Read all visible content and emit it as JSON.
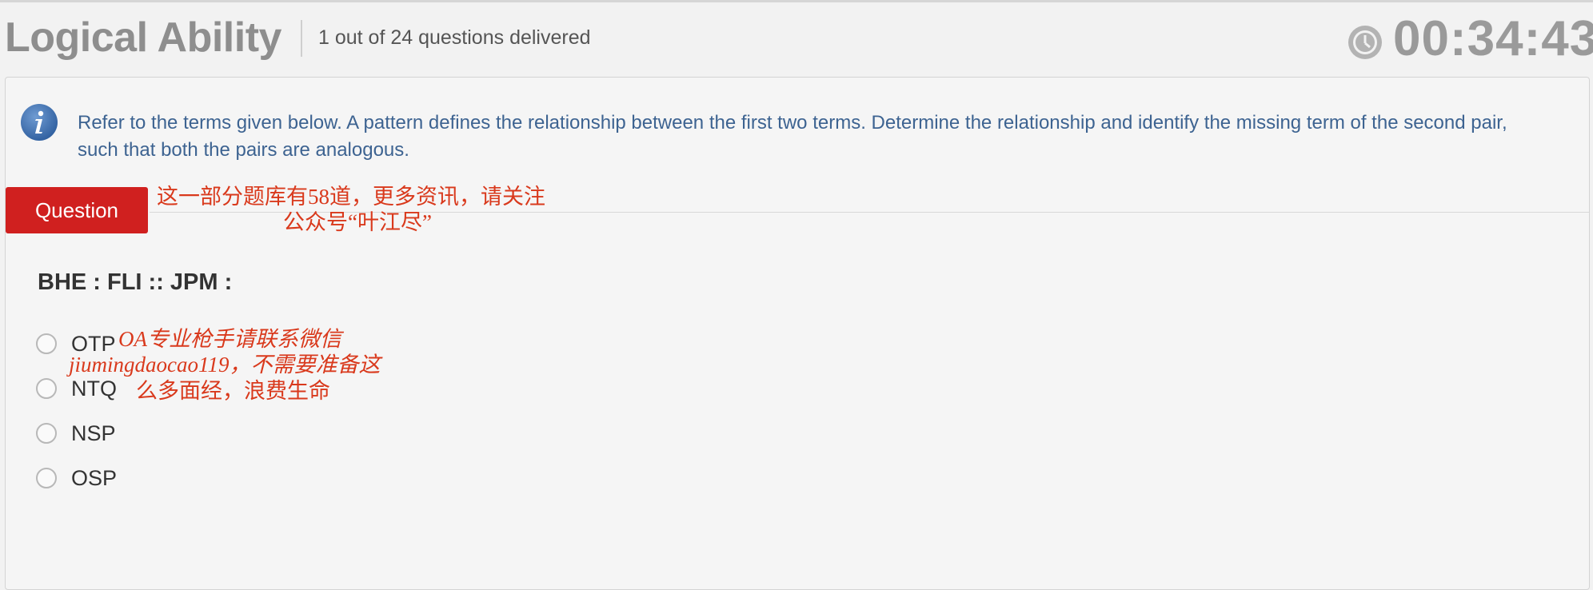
{
  "header": {
    "section_title": "Logical Ability",
    "progress_text": "1 out of 24 questions delivered",
    "timer": "00:34:43"
  },
  "instruction": {
    "text": "Refer to the terms given below. A pattern defines the relationship between the first two terms. Determine the relationship and identify the missing term of the second pair, such that both the pairs are analogous."
  },
  "question": {
    "tab_label": "Question",
    "stem": "BHE : FLI :: JPM :",
    "options": [
      {
        "label": "OTP",
        "selected": false
      },
      {
        "label": "NTQ",
        "selected": false
      },
      {
        "label": "NSP",
        "selected": false
      },
      {
        "label": "OSP",
        "selected": false
      }
    ]
  },
  "watermarks": {
    "line1": "这一部分题库有58道，更多资讯，请关注",
    "line2": "公众号“叶江尽”",
    "line3": "OA专业枪手请联系微信",
    "line4": "jiumingdaocao119，不需要准备这",
    "line5": "么多面经，浪费生命"
  },
  "colors": {
    "accent_red": "#d0201f",
    "instruction_blue": "#3d6391",
    "watermark_red": "#d9391c"
  },
  "icons": {
    "timer": "clock-icon",
    "info": "info-icon"
  }
}
